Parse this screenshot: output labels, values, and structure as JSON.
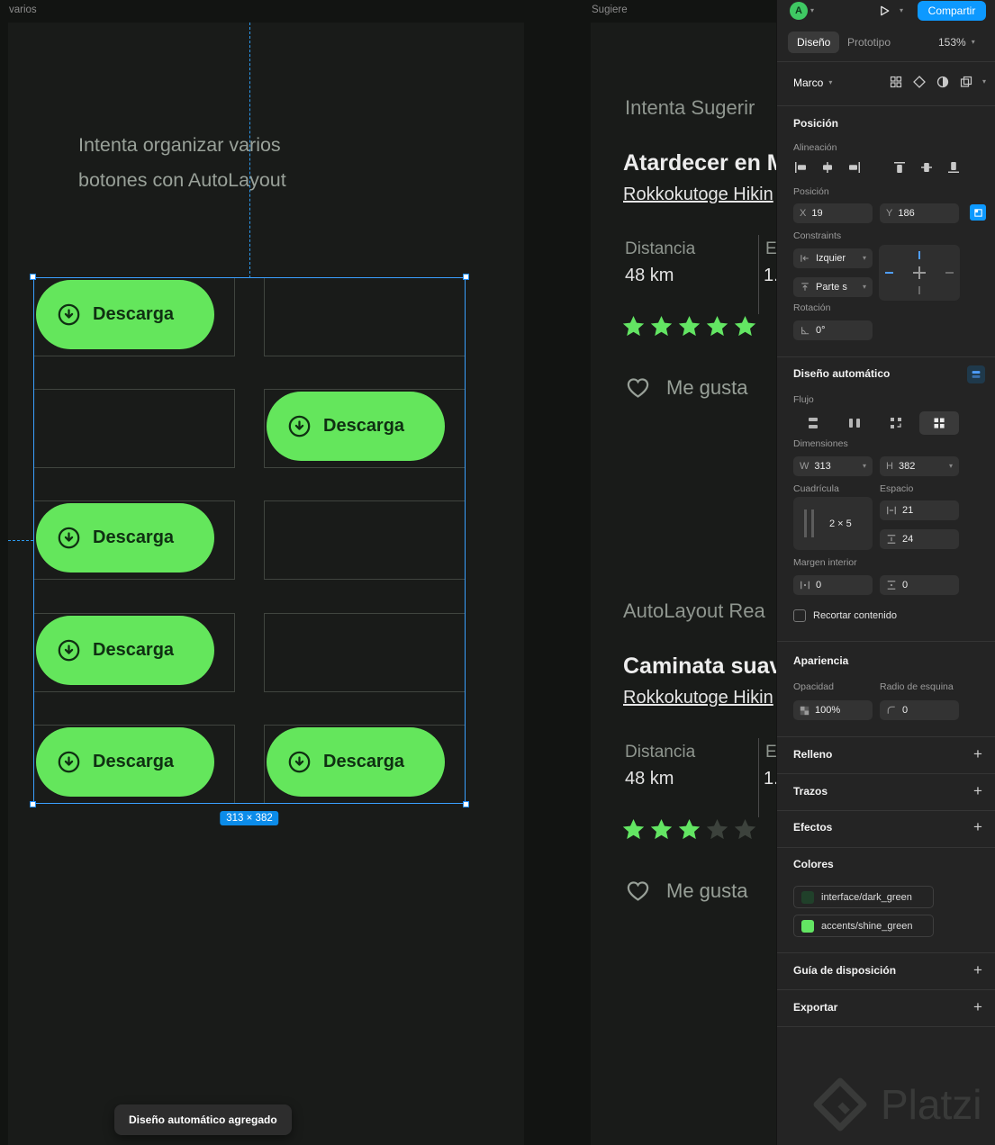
{
  "frame_labels": {
    "left": "varios",
    "right": "Sugiere"
  },
  "left_frame": {
    "title_line1": "Intenta organizar varios",
    "title_line2": "botones con AutoLayout",
    "button_label": "Descarga",
    "grid_pattern": [
      [
        "button",
        "empty"
      ],
      [
        "empty",
        "button"
      ],
      [
        "button",
        "empty"
      ],
      [
        "button",
        "empty"
      ],
      [
        "button",
        "button"
      ]
    ],
    "selection_badge": "313 × 382",
    "toast": "Diseño automático agregado"
  },
  "right_frame": {
    "title": "Intenta Sugerir",
    "cards": [
      {
        "heading": "Atardecer en M",
        "link": "Rokkokutoge Hikin",
        "stat1_label": "Distancia",
        "stat1_value": "48 km",
        "stat2_label": "E",
        "stat2_value": "1.",
        "rating": 5,
        "rating_max": 5,
        "like_label": "Me gusta"
      },
      {
        "section_label": "AutoLayout Rea",
        "heading": "Caminata suav",
        "link": "Rokkokutoge Hikin",
        "stat1_label": "Distancia",
        "stat1_value": "48 km",
        "stat2_label": "E",
        "stat2_value": "1.",
        "rating": 3,
        "rating_max": 5,
        "like_label": "Me gusta"
      }
    ]
  },
  "panel": {
    "topbar": {
      "avatar_letter": "A",
      "share": "Compartir"
    },
    "tabs": {
      "design": "Diseño",
      "prototype": "Prototipo",
      "zoom": "153%"
    },
    "selection_row": {
      "label": "Marco"
    },
    "position": {
      "header": "Posición",
      "alignment_label": "Alineación",
      "position_label": "Posición",
      "x_label": "X",
      "x_value": "19",
      "y_label": "Y",
      "y_value": "186",
      "constraints_label": "Constraints",
      "h_constraint": "Izquier",
      "v_constraint": "Parte s",
      "rotation_label": "Rotación",
      "rotation_value": "0°"
    },
    "auto_layout": {
      "header": "Diseño automático",
      "flow_label": "Flujo",
      "dimensions_label": "Dimensiones",
      "w_label": "W",
      "w_value": "313",
      "h_label": "H",
      "h_value": "382",
      "grid_label": "Cuadrícula",
      "grid_value": "2 × 5",
      "spacing_label": "Espacio",
      "h_spacing": "21",
      "v_spacing": "24",
      "padding_label": "Margen interior",
      "h_padding": "0",
      "v_padding": "0",
      "clip_label": "Recortar contenido"
    },
    "appearance": {
      "header": "Apariencia",
      "opacity_label": "Opacidad",
      "opacity_value": "100%",
      "radius_label": "Radio de esquina",
      "radius_value": "0"
    },
    "fill_header": "Relleno",
    "stroke_header": "Trazos",
    "effects_header": "Efectos",
    "colors_header": "Colores",
    "color_styles": [
      {
        "name": "interface/dark_green",
        "hex": "#20402a"
      },
      {
        "name": "accents/shine_green",
        "hex": "#63e563"
      }
    ],
    "layout_guide_header": "Guía de disposición",
    "export_header": "Exportar"
  },
  "colors": {
    "accent_blue": "#0d99ff",
    "shine_green": "#63e563",
    "star_empty": "#3c423c"
  },
  "icons": {
    "chevron_down": "▾",
    "plus": "+"
  },
  "watermark": "Platzi"
}
